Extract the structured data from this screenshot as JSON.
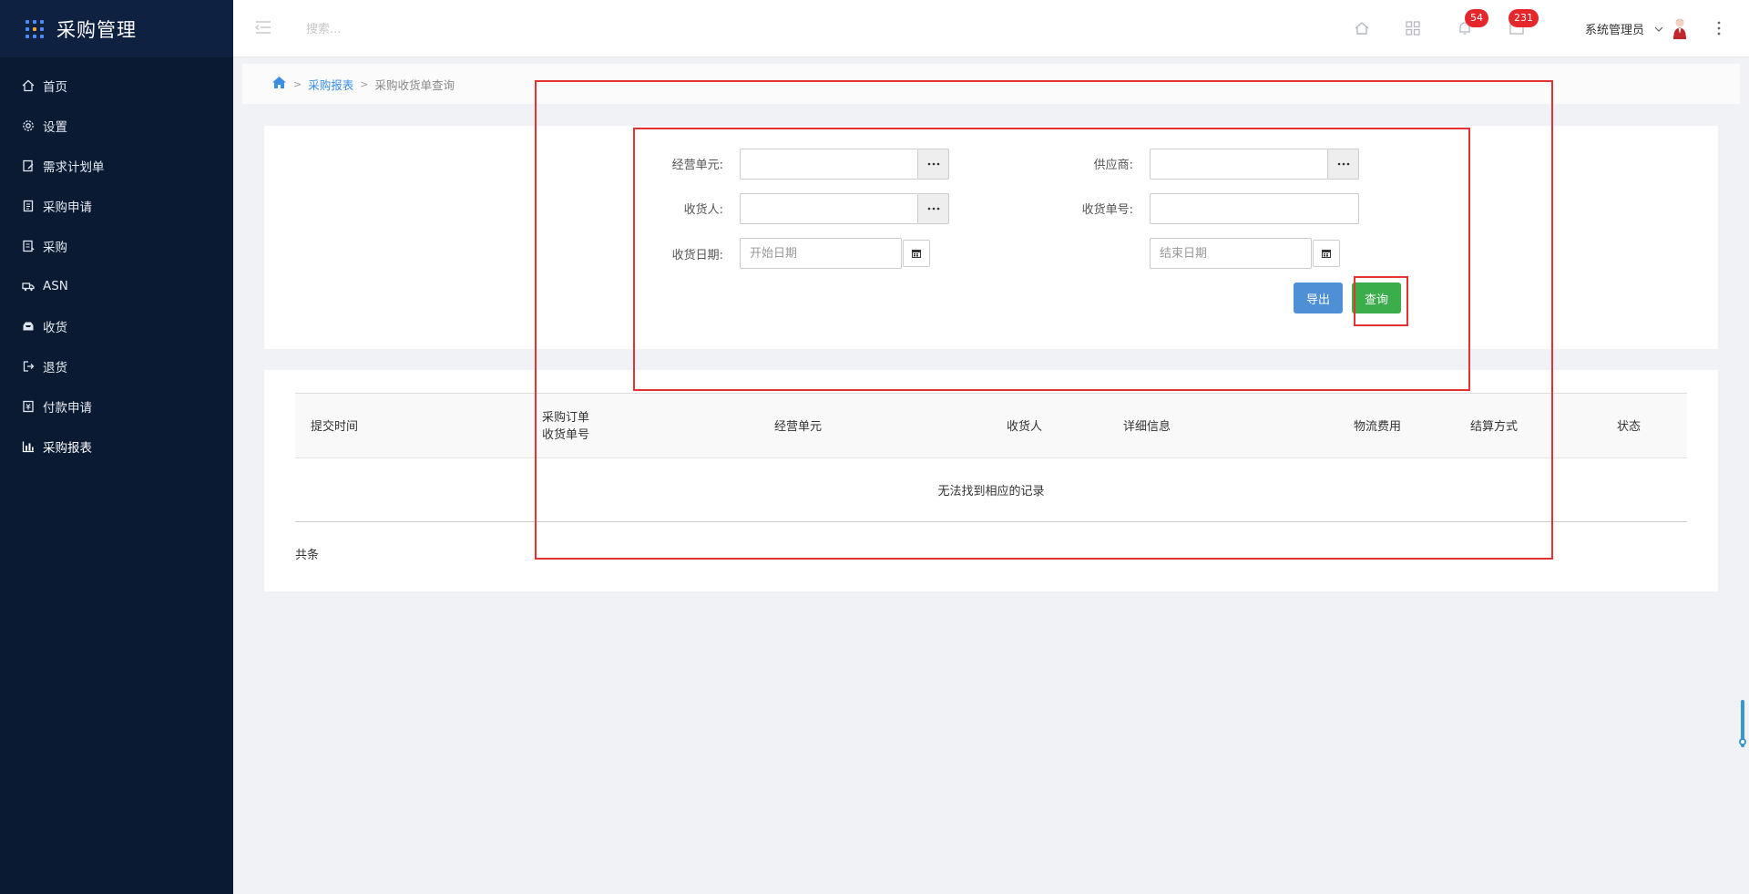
{
  "app": {
    "title": "采购管理"
  },
  "sidebar": {
    "items": [
      {
        "label": "首页",
        "icon": "home-icon"
      },
      {
        "label": "设置",
        "icon": "gear-icon"
      },
      {
        "label": "需求计划单",
        "icon": "document-edit-icon"
      },
      {
        "label": "采购申请",
        "icon": "form-icon"
      },
      {
        "label": "采购",
        "icon": "list-icon"
      },
      {
        "label": "ASN",
        "icon": "truck-icon"
      },
      {
        "label": "收货",
        "icon": "inbox-icon"
      },
      {
        "label": "退货",
        "icon": "exit-icon"
      },
      {
        "label": "付款申请",
        "icon": "payment-icon"
      },
      {
        "label": "采购报表",
        "icon": "bar-chart-icon"
      }
    ],
    "active_index": 9
  },
  "topbar": {
    "search_placeholder": "搜索...",
    "notifications_count": "54",
    "messages_count": "231",
    "user_name": "系统管理员"
  },
  "breadcrumb": {
    "parent": "采购报表",
    "current": "采购收货单查询"
  },
  "filter": {
    "business_unit_label": "经营单元:",
    "supplier_label": "供应商:",
    "receiver_label": "收货人:",
    "receipt_no_label": "收货单号:",
    "receipt_date_label": "收货日期:",
    "start_date_placeholder": "开始日期",
    "end_date_placeholder": "结束日期",
    "export_label": "导出",
    "query_label": "查询"
  },
  "table": {
    "columns": {
      "submit_time": "提交时间",
      "po_no": "采购订单",
      "receipt_no": "收货单号",
      "business_unit": "经营单元",
      "receiver": "收货人",
      "details": "详细信息",
      "logistics_fee": "物流费用",
      "settlement": "结算方式",
      "status": "状态"
    },
    "empty_text": "无法找到相应的记录",
    "total_label": "共条"
  },
  "colors": {
    "sidebar_bg": "#0a1a33",
    "accent_blue": "#3a8ee6",
    "query_green": "#3aae4b",
    "badge_red": "#e5262b",
    "annotation_red": "#e53333"
  }
}
